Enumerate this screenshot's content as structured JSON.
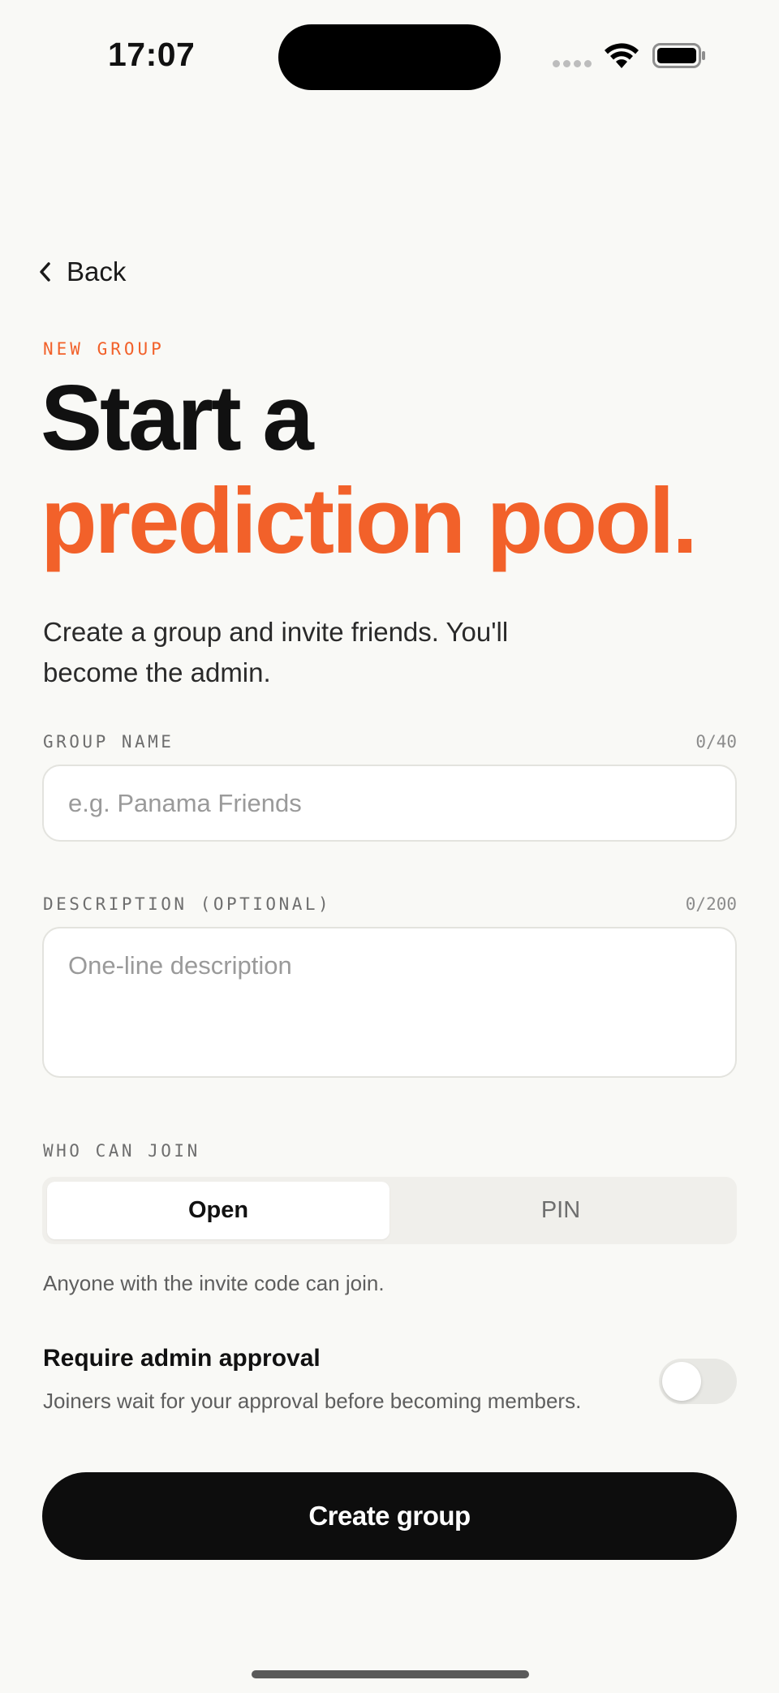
{
  "status_bar": {
    "time": "17:07"
  },
  "nav": {
    "back_label": "Back"
  },
  "header": {
    "eyebrow": "NEW GROUP",
    "title_line1": "Start a",
    "title_line2": "prediction pool.",
    "accent_color": "#F2612A"
  },
  "intro": "Create a group and invite friends. You'll become the admin.",
  "form": {
    "group_name": {
      "label": "GROUP NAME",
      "counter": "0/40",
      "value": "",
      "placeholder": "e.g. Panama Friends"
    },
    "description": {
      "label": "DESCRIPTION (OPTIONAL)",
      "counter": "0/200",
      "value": "",
      "placeholder": "One-line description"
    },
    "who_can_join": {
      "label": "WHO CAN JOIN",
      "options": [
        "Open",
        "PIN"
      ],
      "selected": "Open",
      "hint": "Anyone with the invite code can join."
    },
    "approval": {
      "title": "Require admin approval",
      "subtitle": "Joiners wait for your approval before becoming members.",
      "enabled": false
    }
  },
  "submit_label": "Create group",
  "icons": [
    "chevron-left-icon",
    "wifi-icon",
    "battery-icon",
    "cellular-signal-icon"
  ]
}
